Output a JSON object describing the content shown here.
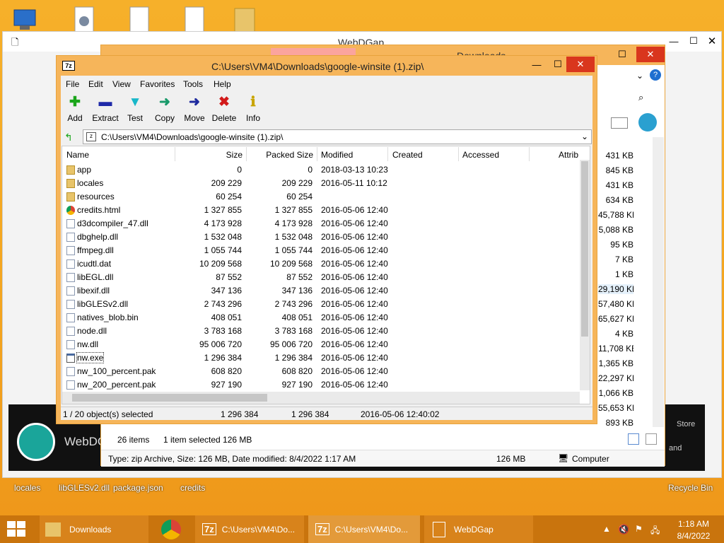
{
  "desktop": {
    "icons": [
      {
        "label": "locales"
      },
      {
        "label": "libGLESv2.dll"
      },
      {
        "label": "package.json"
      },
      {
        "label": "credits"
      },
      {
        "label": "Recycle Bin"
      }
    ]
  },
  "webdgap": {
    "title": "WebDGap",
    "app_name": "WebDG",
    "store_label": "Store",
    "and_label": "and"
  },
  "explorer": {
    "title": "Downloads",
    "sizes": [
      "431 KB",
      "845 KB",
      "431 KB",
      "634 KB",
      "45,788 KB",
      "5,088 KB",
      "95 KB",
      "7 KB",
      "1 KB",
      "29,190 KB",
      "57,480 KB",
      "65,627 KB",
      "4 KB",
      "11,708 KB",
      "1,365 KB",
      "22,297 KB",
      "1,066 KB",
      "55,653 KB",
      "893 KB"
    ],
    "items_count": "26 items",
    "selected_info": "1 item selected  126 MB",
    "details": "Type: zip Archive, Size: 126 MB, Date modified: 8/4/2022 1:17 AM",
    "details_size": "126 MB",
    "location": "Computer"
  },
  "sevenzip": {
    "title": "C:\\Users\\VM4\\Downloads\\google-winsite (1).zip\\",
    "menu": [
      "File",
      "Edit",
      "View",
      "Favorites",
      "Tools",
      "Help"
    ],
    "toolbar": [
      {
        "label": "Add",
        "color": "#1aa51a"
      },
      {
        "label": "Extract",
        "color": "#1f2aa8"
      },
      {
        "label": "Test",
        "color": "#18b7c9"
      },
      {
        "label": "Copy",
        "color": "#199a6a"
      },
      {
        "label": "Move",
        "color": "#1e2a9e"
      },
      {
        "label": "Delete",
        "color": "#d21a1a"
      },
      {
        "label": "Info",
        "color": "#c8a400"
      }
    ],
    "path": "C:\\Users\\VM4\\Downloads\\google-winsite (1).zip\\",
    "columns": [
      "Name",
      "Size",
      "Packed Size",
      "Modified",
      "Created",
      "Accessed",
      "Attrib"
    ],
    "files": [
      {
        "name": "app",
        "size": "0",
        "packed": "0",
        "modified": "2018-03-13 10:23",
        "icon": "folder-icon"
      },
      {
        "name": "locales",
        "size": "209 229",
        "packed": "209 229",
        "modified": "2016-05-11 10:12",
        "icon": "folder-icon"
      },
      {
        "name": "resources",
        "size": "60 254",
        "packed": "60 254",
        "modified": "",
        "icon": "folder-icon"
      },
      {
        "name": "credits.html",
        "size": "1 327 855",
        "packed": "1 327 855",
        "modified": "2016-05-06 12:40",
        "icon": "chrome-icon"
      },
      {
        "name": "d3dcompiler_47.dll",
        "size": "4 173 928",
        "packed": "4 173 928",
        "modified": "2016-05-06 12:40",
        "icon": "dll-icon"
      },
      {
        "name": "dbghelp.dll",
        "size": "1 532 048",
        "packed": "1 532 048",
        "modified": "2016-05-06 12:40",
        "icon": "dll-icon"
      },
      {
        "name": "ffmpeg.dll",
        "size": "1 055 744",
        "packed": "1 055 744",
        "modified": "2016-05-06 12:40",
        "icon": "dll-icon"
      },
      {
        "name": "icudtl.dat",
        "size": "10 209 568",
        "packed": "10 209 568",
        "modified": "2016-05-06 12:40",
        "icon": "file-icon"
      },
      {
        "name": "libEGL.dll",
        "size": "87 552",
        "packed": "87 552",
        "modified": "2016-05-06 12:40",
        "icon": "dll-icon"
      },
      {
        "name": "libexif.dll",
        "size": "347 136",
        "packed": "347 136",
        "modified": "2016-05-06 12:40",
        "icon": "dll-icon"
      },
      {
        "name": "libGLESv2.dll",
        "size": "2 743 296",
        "packed": "2 743 296",
        "modified": "2016-05-06 12:40",
        "icon": "dll-icon"
      },
      {
        "name": "natives_blob.bin",
        "size": "408 051",
        "packed": "408 051",
        "modified": "2016-05-06 12:40",
        "icon": "file-icon"
      },
      {
        "name": "node.dll",
        "size": "3 783 168",
        "packed": "3 783 168",
        "modified": "2016-05-06 12:40",
        "icon": "dll-icon"
      },
      {
        "name": "nw.dll",
        "size": "95 006 720",
        "packed": "95 006 720",
        "modified": "2016-05-06 12:40",
        "icon": "dll-icon"
      },
      {
        "name": "nw.exe",
        "size": "1 296 384",
        "packed": "1 296 384",
        "modified": "2016-05-06 12:40",
        "icon": "exe-icon",
        "selected": true
      },
      {
        "name": "nw_100_percent.pak",
        "size": "608 820",
        "packed": "608 820",
        "modified": "2016-05-06 12:40",
        "icon": "file-icon"
      },
      {
        "name": "nw_200_percent.pak",
        "size": "927 190",
        "packed": "927 190",
        "modified": "2016-05-06 12:40",
        "icon": "file-icon"
      }
    ],
    "status": {
      "selected": "1 / 20 object(s) selected",
      "size": "1 296 384",
      "packed": "1 296 384",
      "modified": "2016-05-06 12:40:02"
    }
  },
  "taskbar": {
    "items": [
      {
        "label": "Downloads"
      },
      {
        "label": ""
      },
      {
        "label": "C:\\Users\\VM4\\Do..."
      },
      {
        "label": "C:\\Users\\VM4\\Do..."
      },
      {
        "label": "WebDGap"
      }
    ],
    "time": "1:18 AM",
    "date": "8/4/2022"
  },
  "colors": {
    "accent": "#f2a21c",
    "window_border": "#e8a33c",
    "taskbar": "#c9740d",
    "close": "#d9361d"
  }
}
